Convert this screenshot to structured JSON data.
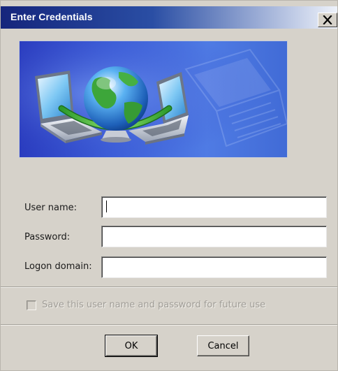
{
  "window": {
    "title": "Enter Credentials",
    "close_glyph": "✕"
  },
  "banner": {
    "icon": "network-globe-laptops-illustration"
  },
  "form": {
    "username_label": "User name:",
    "username_value": "",
    "password_label": "Password:",
    "password_value": "",
    "domain_label": "Logon domain:",
    "domain_value": ""
  },
  "save_option": {
    "label": "Save this user name and password for future use",
    "checked": false,
    "enabled": false
  },
  "buttons": {
    "ok_label": "OK",
    "cancel_label": "Cancel"
  },
  "colors": {
    "titlebar_start": "#15257c",
    "titlebar_end": "#eef2fa",
    "dialog_background": "#d6d2ca",
    "disabled_text": "#a09d97"
  }
}
